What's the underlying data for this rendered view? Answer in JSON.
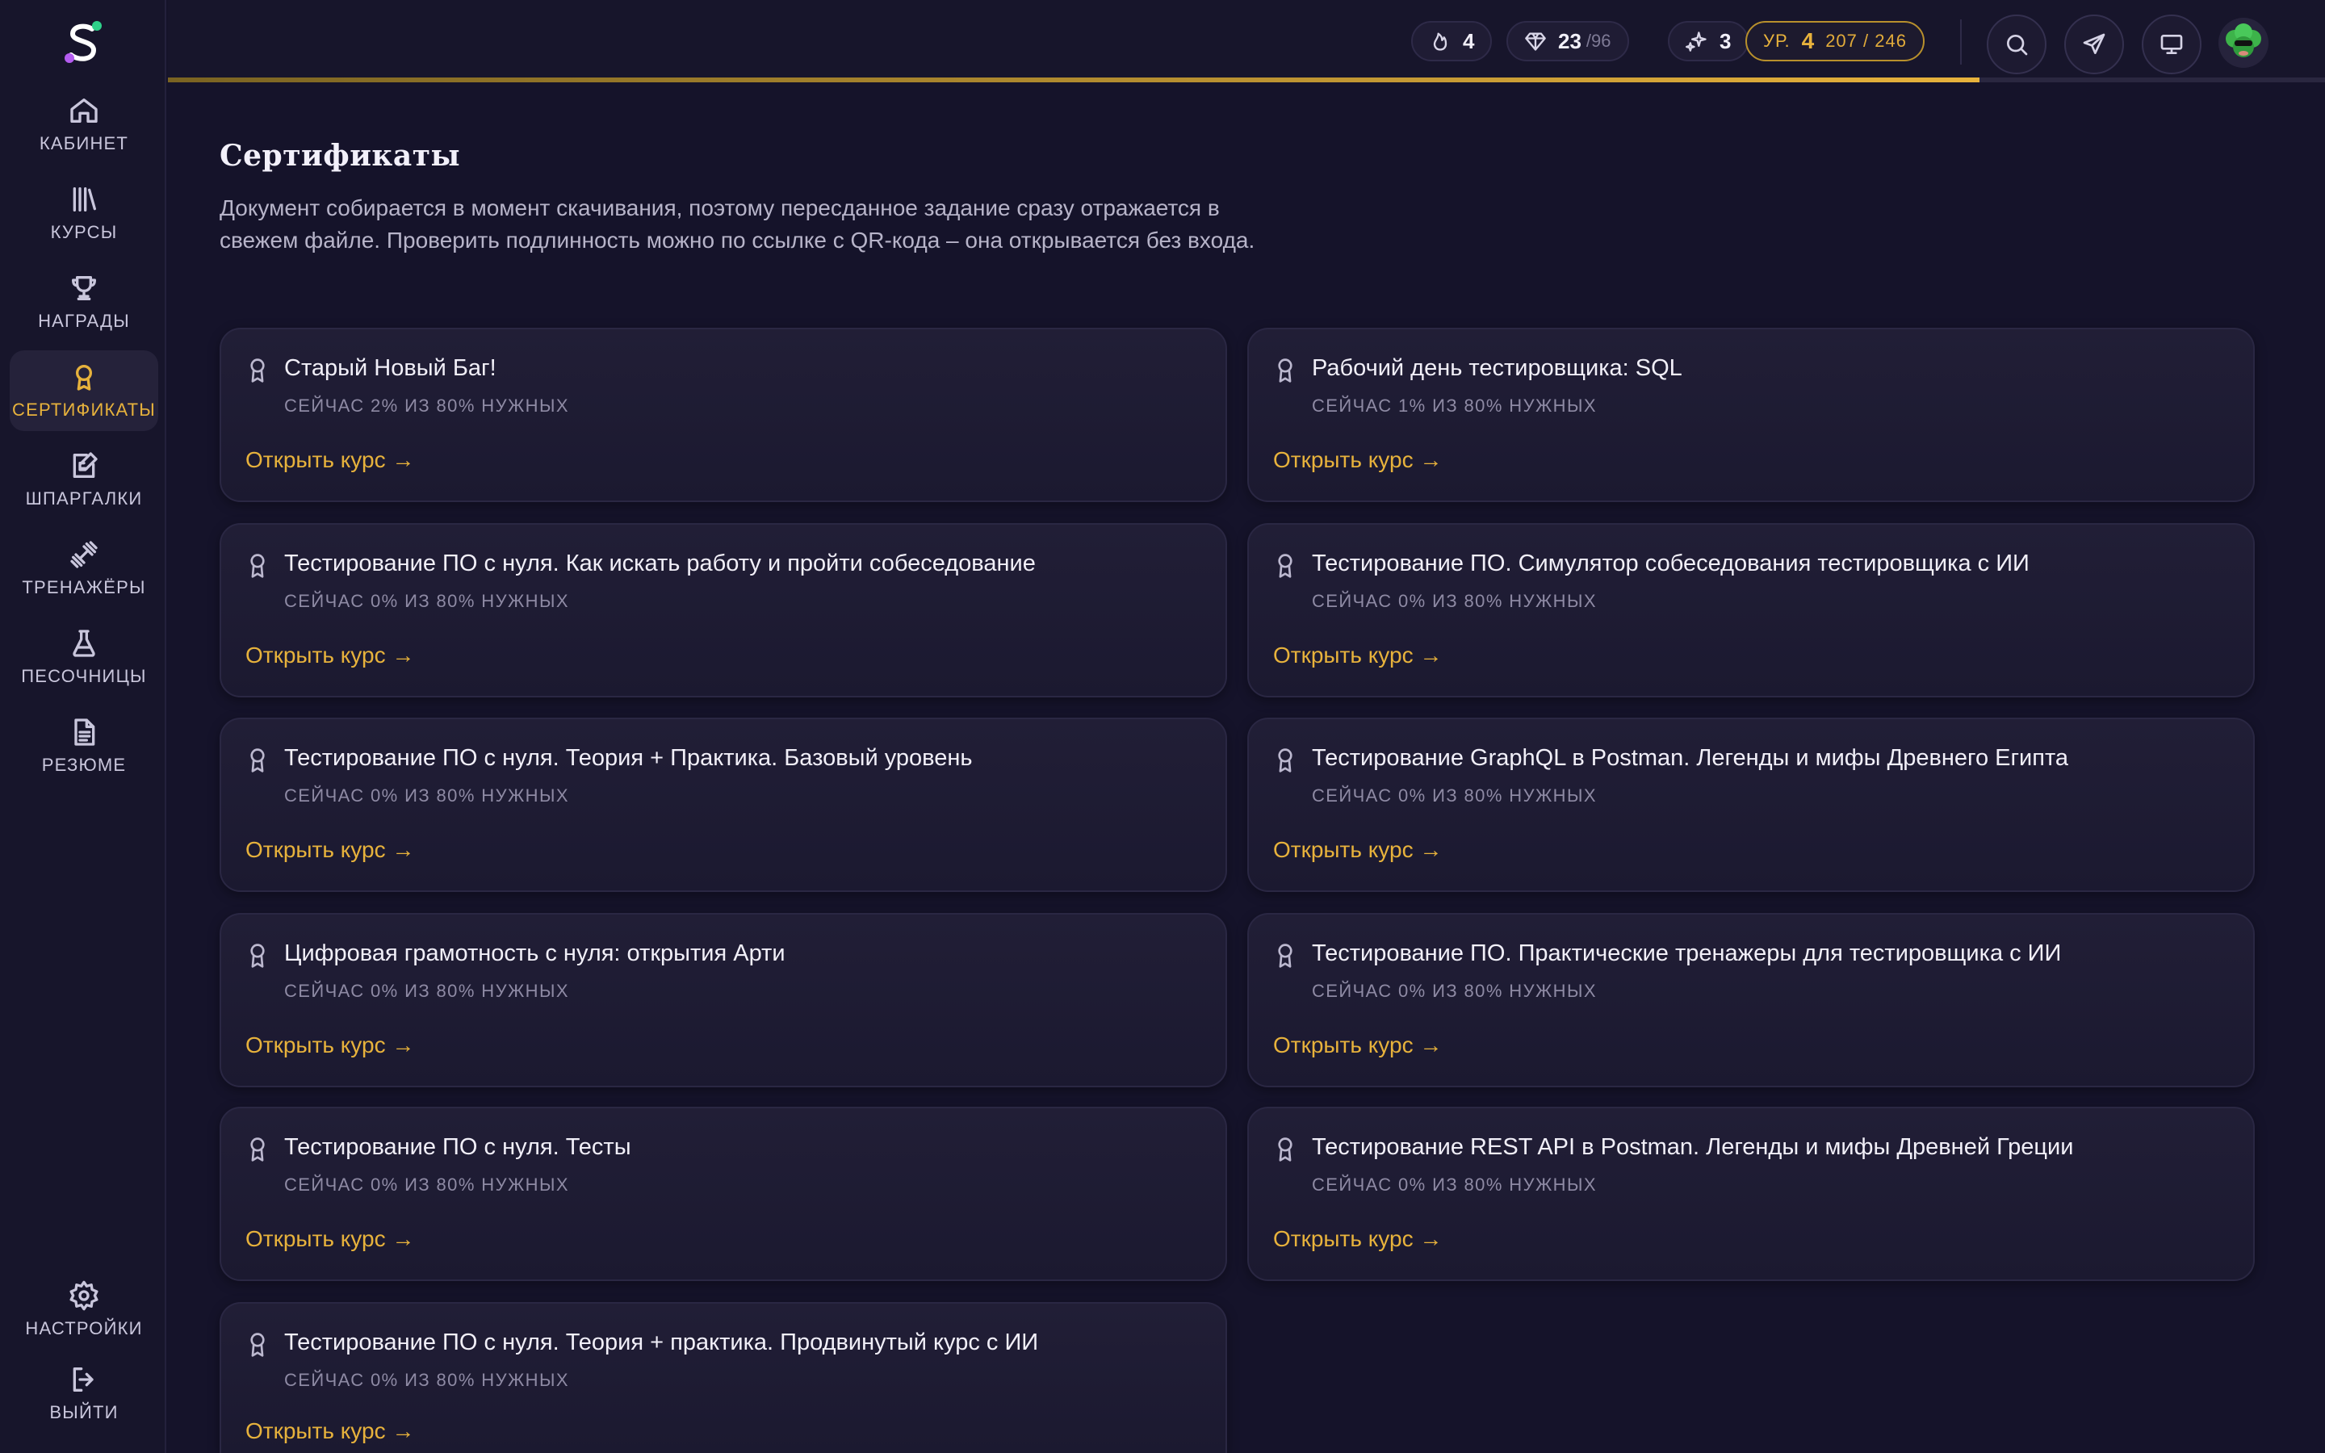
{
  "sidebar": {
    "items": [
      {
        "label": "КАБИНЕТ",
        "icon": "home-icon"
      },
      {
        "label": "КУРСЫ",
        "icon": "library-icon"
      },
      {
        "label": "НАГРАДЫ",
        "icon": "trophy-icon"
      },
      {
        "label": "СЕРТИФИКАТЫ",
        "icon": "certificate-icon",
        "active": true
      },
      {
        "label": "ШПАРГАЛКИ",
        "icon": "note-edit-icon"
      },
      {
        "label": "ТРЕНАЖЁРЫ",
        "icon": "dumbbell-icon"
      },
      {
        "label": "ПЕСОЧНИЦЫ",
        "icon": "flask-icon"
      },
      {
        "label": "РЕЗЮМЕ",
        "icon": "document-icon"
      }
    ],
    "settings_label": "НАСТРОЙКИ",
    "logout_label": "ВЫЙТИ"
  },
  "topbar": {
    "streak": "4",
    "gems": "23",
    "gems_total": "/96",
    "sparks": "3",
    "level_prefix": "УР.",
    "level": "4",
    "xp": "207 / 246",
    "xp_progress": 0.84
  },
  "colors": {
    "accent": "#e7b23c",
    "background": "#15132a",
    "card": "#211e36"
  },
  "page": {
    "title": "Сертификаты",
    "description": "Документ собирается в момент скачивания, поэтому пересданное задание сразу отражается в свежем файле. Проверить подлинность можно по ссылке с QR-кода – она открывается без входа."
  },
  "link_label": "Открыть курс →",
  "certificates": [
    {
      "title": "Старый Новый Баг!",
      "progress": "СЕЙЧАС 2% ИЗ 80% НУЖНЫХ"
    },
    {
      "title": "Рабочий день тестировщика: SQL",
      "progress": "СЕЙЧАС 1% ИЗ 80% НУЖНЫХ"
    },
    {
      "title": "Тестирование ПО с нуля. Как искать работу и пройти собеседование",
      "progress": "СЕЙЧАС 0% ИЗ 80% НУЖНЫХ"
    },
    {
      "title": "Тестирование ПО. Симулятор собеседования тестировщика с ИИ",
      "progress": "СЕЙЧАС 0% ИЗ 80% НУЖНЫХ"
    },
    {
      "title": "Тестирование ПО с нуля. Теория + Практика. Базовый уровень",
      "progress": "СЕЙЧАС 0% ИЗ 80% НУЖНЫХ"
    },
    {
      "title": "Тестирование GraphQL в Postman. Легенды и мифы Древнего Египта",
      "progress": "СЕЙЧАС 0% ИЗ 80% НУЖНЫХ"
    },
    {
      "title": "Цифровая грамотность с нуля: открытия Арти",
      "progress": "СЕЙЧАС 0% ИЗ 80% НУЖНЫХ"
    },
    {
      "title": "Тестирование ПО. Практические тренажеры для тестировщика с ИИ",
      "progress": "СЕЙЧАС 0% ИЗ 80% НУЖНЫХ"
    },
    {
      "title": "Тестирование ПО с нуля. Тесты",
      "progress": "СЕЙЧАС 0% ИЗ 80% НУЖНЫХ"
    },
    {
      "title": "Тестирование REST API в Postman. Легенды и мифы Древней Греции",
      "progress": "СЕЙЧАС 0% ИЗ 80% НУЖНЫХ"
    },
    {
      "title": "Тестирование ПО с нуля. Теория + практика. Продвинутый курс с ИИ",
      "progress": "СЕЙЧАС 0% ИЗ 80% НУЖНЫХ"
    }
  ]
}
